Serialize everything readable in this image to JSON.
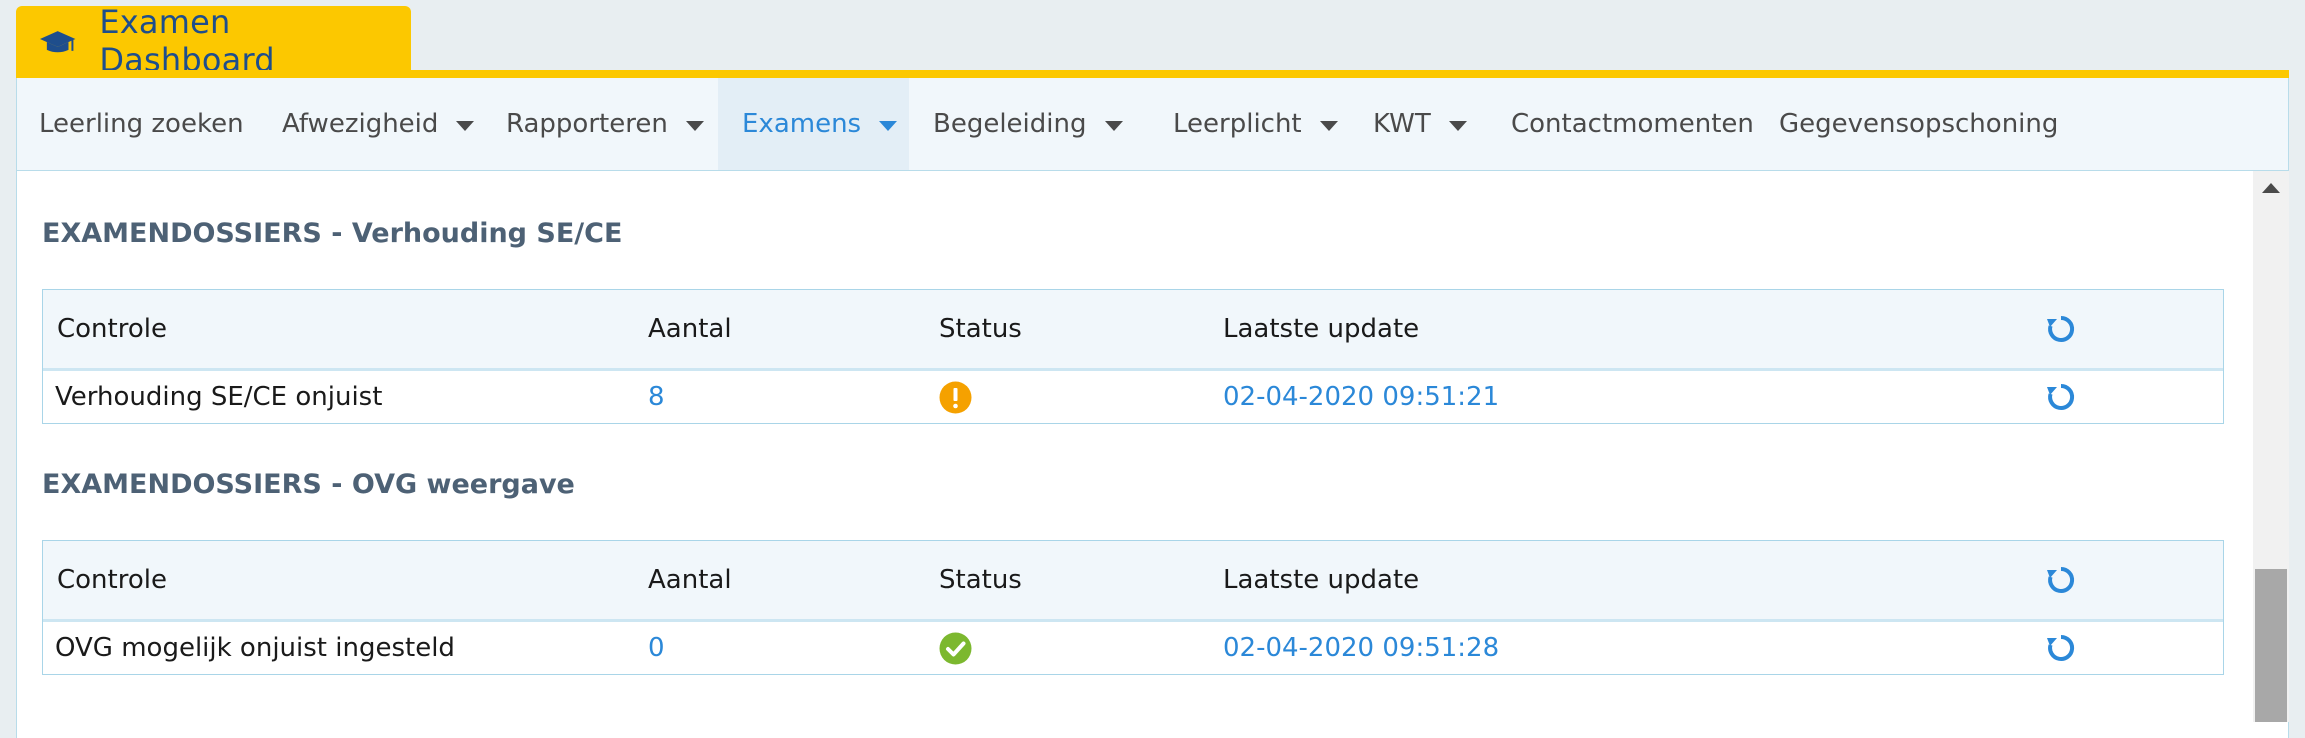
{
  "header": {
    "title": "Examen Dashboard",
    "icon": "graduation-cap-icon",
    "color": "#fcc800"
  },
  "nav": {
    "items": [
      {
        "label": "Leerling zoeken",
        "dropdown": false,
        "active": false
      },
      {
        "label": "Afwezigheid",
        "dropdown": true,
        "active": false
      },
      {
        "label": "Rapporteren",
        "dropdown": true,
        "active": false
      },
      {
        "label": "Examens",
        "dropdown": true,
        "active": true
      },
      {
        "label": "Begeleiding",
        "dropdown": true,
        "active": false
      },
      {
        "label": "Leerplicht",
        "dropdown": true,
        "active": false
      },
      {
        "label": "KWT",
        "dropdown": true,
        "active": false
      },
      {
        "label": "Contactmomenten",
        "dropdown": false,
        "active": false
      },
      {
        "label": "Gegevensopschoning",
        "dropdown": false,
        "active": false
      }
    ]
  },
  "sections": [
    {
      "title": "EXAMENDOSSIERS - Verhouding SE/CE",
      "columns": [
        "Controle",
        "Aantal",
        "Status",
        "Laatste update"
      ],
      "row": {
        "controle": "Verhouding SE/CE onjuist",
        "aantal": "8",
        "status": "warning",
        "laatste_update": "02-04-2020 09:51:21"
      }
    },
    {
      "title": "EXAMENDOSSIERS - OVG weergave",
      "columns": [
        "Controle",
        "Aantal",
        "Status",
        "Laatste update"
      ],
      "row": {
        "controle": "OVG mogelijk onjuist ingesteld",
        "aantal": "0",
        "status": "ok",
        "laatste_update": "02-04-2020 09:51:28"
      }
    }
  ],
  "colors": {
    "accent": "#2b88d8",
    "warning": "#f5a100",
    "ok": "#7cb82f"
  }
}
